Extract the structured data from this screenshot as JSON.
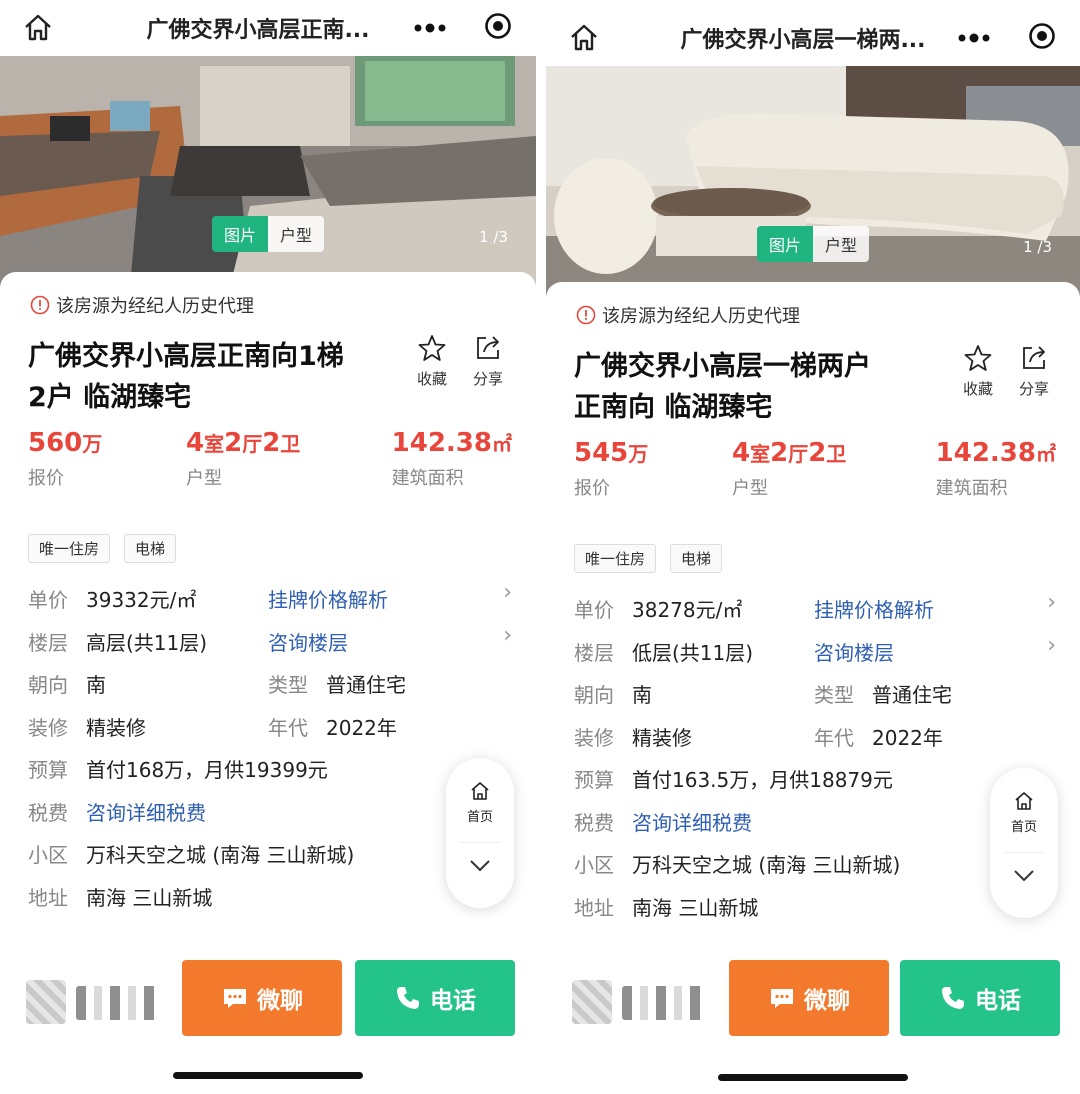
{
  "listings": [
    {
      "topbar_title": "广佛交界小高层正南...",
      "hero": {
        "tab_photos": "图片",
        "tab_layout": "户型",
        "count": "1 /3"
      },
      "notice": "该房源为经纪人历史代理",
      "title_line1": "广佛交界小高层正南向1梯",
      "title_line2": "2户 临湖臻宅",
      "actions": {
        "favorite": "收藏",
        "share": "分享"
      },
      "price": {
        "value": "560",
        "unit": "万",
        "label": "报价"
      },
      "layout": {
        "rooms": "4",
        "rooms_unit": "室",
        "halls": "2",
        "halls_unit": "厅",
        "baths": "2",
        "baths_unit": "卫",
        "label": "户型"
      },
      "area": {
        "value": "142.38",
        "unit": "㎡",
        "label": "建筑面积"
      },
      "tags": [
        "唯一住房",
        "电梯"
      ],
      "info": {
        "unit_price_label": "单价",
        "unit_price": "39332元/㎡",
        "price_analysis": "挂牌价格解析",
        "floor_label": "楼层",
        "floor": "高层(共11层)",
        "floor_consult": "咨询楼层",
        "orient_label": "朝向",
        "orient": "南",
        "type_label": "类型",
        "type": "普通住宅",
        "deco_label": "装修",
        "deco": "精装修",
        "year_label": "年代",
        "year": "2022年",
        "budget_label": "预算",
        "budget": "首付168万，月供19399元",
        "tax_label": "税费",
        "tax": "咨询详细税费",
        "community_label": "小区",
        "community": "万科天空之城 (南海 三山新城)",
        "address_label": "地址",
        "address": "南海 三山新城"
      },
      "float_home": "首页",
      "buttons": {
        "chat": "微聊",
        "call": "电话"
      }
    },
    {
      "topbar_title": "广佛交界小高层一梯两...",
      "hero": {
        "tab_photos": "图片",
        "tab_layout": "户型",
        "count": "1 /3"
      },
      "notice": "该房源为经纪人历史代理",
      "title_line1": "广佛交界小高层一梯两户",
      "title_line2": "正南向 临湖臻宅",
      "actions": {
        "favorite": "收藏",
        "share": "分享"
      },
      "price": {
        "value": "545",
        "unit": "万",
        "label": "报价"
      },
      "layout": {
        "rooms": "4",
        "rooms_unit": "室",
        "halls": "2",
        "halls_unit": "厅",
        "baths": "2",
        "baths_unit": "卫",
        "label": "户型"
      },
      "area": {
        "value": "142.38",
        "unit": "㎡",
        "label": "建筑面积"
      },
      "tags": [
        "唯一住房",
        "电梯"
      ],
      "info": {
        "unit_price_label": "单价",
        "unit_price": "38278元/㎡",
        "price_analysis": "挂牌价格解析",
        "floor_label": "楼层",
        "floor": "低层(共11层)",
        "floor_consult": "咨询楼层",
        "orient_label": "朝向",
        "orient": "南",
        "type_label": "类型",
        "type": "普通住宅",
        "deco_label": "装修",
        "deco": "精装修",
        "year_label": "年代",
        "year": "2022年",
        "budget_label": "预算",
        "budget": "首付163.5万，月供18879元",
        "tax_label": "税费",
        "tax": "咨询详细税费",
        "community_label": "小区",
        "community": "万科天空之城 (南海 三山新城)",
        "address_label": "地址",
        "address": "南海 三山新城"
      },
      "float_home": "首页",
      "buttons": {
        "chat": "微聊",
        "call": "电话"
      }
    }
  ],
  "colors": {
    "price_red": "#e8463b",
    "link_blue": "#2f5fb3",
    "chat_orange": "#f37a2c",
    "call_green": "#23c38a",
    "tab_green": "#1fb480"
  },
  "icons": [
    "home-icon",
    "more-icon",
    "target-icon",
    "warning-icon",
    "star-icon",
    "share-icon",
    "chevron-right-icon",
    "chevron-down-icon",
    "chat-icon",
    "phone-icon"
  ]
}
